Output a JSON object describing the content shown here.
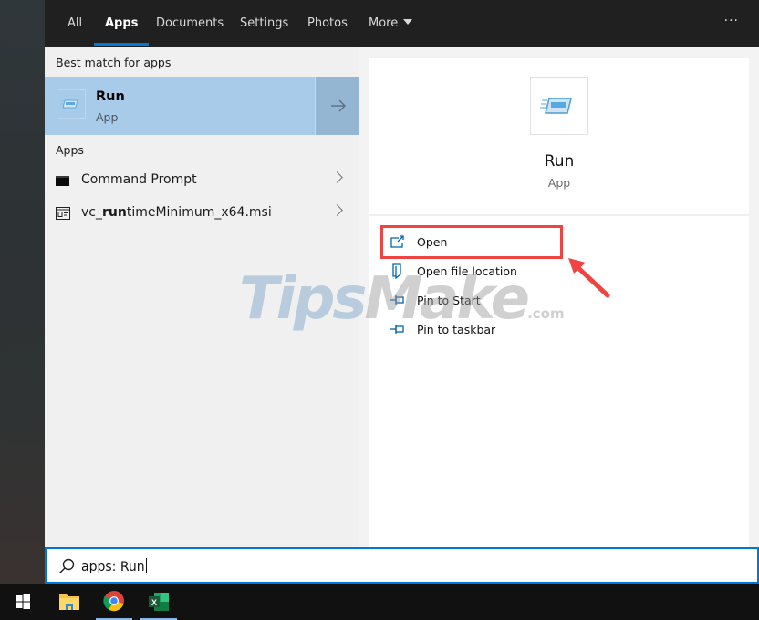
{
  "nav": {
    "tabs": [
      {
        "label": "All",
        "active": false
      },
      {
        "label": "Apps",
        "active": true
      },
      {
        "label": "Documents",
        "active": false
      },
      {
        "label": "Settings",
        "active": false
      },
      {
        "label": "Photos",
        "active": false
      },
      {
        "label": "More",
        "active": false
      }
    ],
    "overflow": "···",
    "accent_color": "#0078d7"
  },
  "results": {
    "best_match_title": "Best match for apps",
    "best_match": {
      "name": "Run",
      "type": "App",
      "icon": "run-icon"
    },
    "apps_title": "Apps",
    "apps": [
      {
        "label": "Command Prompt",
        "icon": "command-prompt-icon"
      },
      {
        "label_pre": "vc_",
        "label_bold": "run",
        "label_post": "timeMinimum_x64.msi",
        "icon": "msi-installer-icon"
      }
    ]
  },
  "preview": {
    "name": "Run",
    "type": "App",
    "actions": [
      {
        "label": "Open",
        "icon": "open-external-icon",
        "highlighted": true
      },
      {
        "label": "Open file location",
        "icon": "file-location-icon"
      },
      {
        "label": "Pin to Start",
        "icon": "pin-icon"
      },
      {
        "label": "Pin to taskbar",
        "icon": "pin-icon"
      }
    ],
    "highlight_color": "#ef4444"
  },
  "watermark": {
    "part1": "Tips",
    "part2": "Make",
    "suffix": ".com"
  },
  "search": {
    "value": "apps: Run"
  },
  "taskbar": {
    "items": [
      {
        "name": "start",
        "icon": "windows-logo-icon"
      },
      {
        "name": "file-explorer",
        "icon": "folder-icon"
      },
      {
        "name": "chrome",
        "icon": "chrome-icon"
      },
      {
        "name": "excel",
        "icon": "excel-icon",
        "letter": "X"
      }
    ]
  }
}
